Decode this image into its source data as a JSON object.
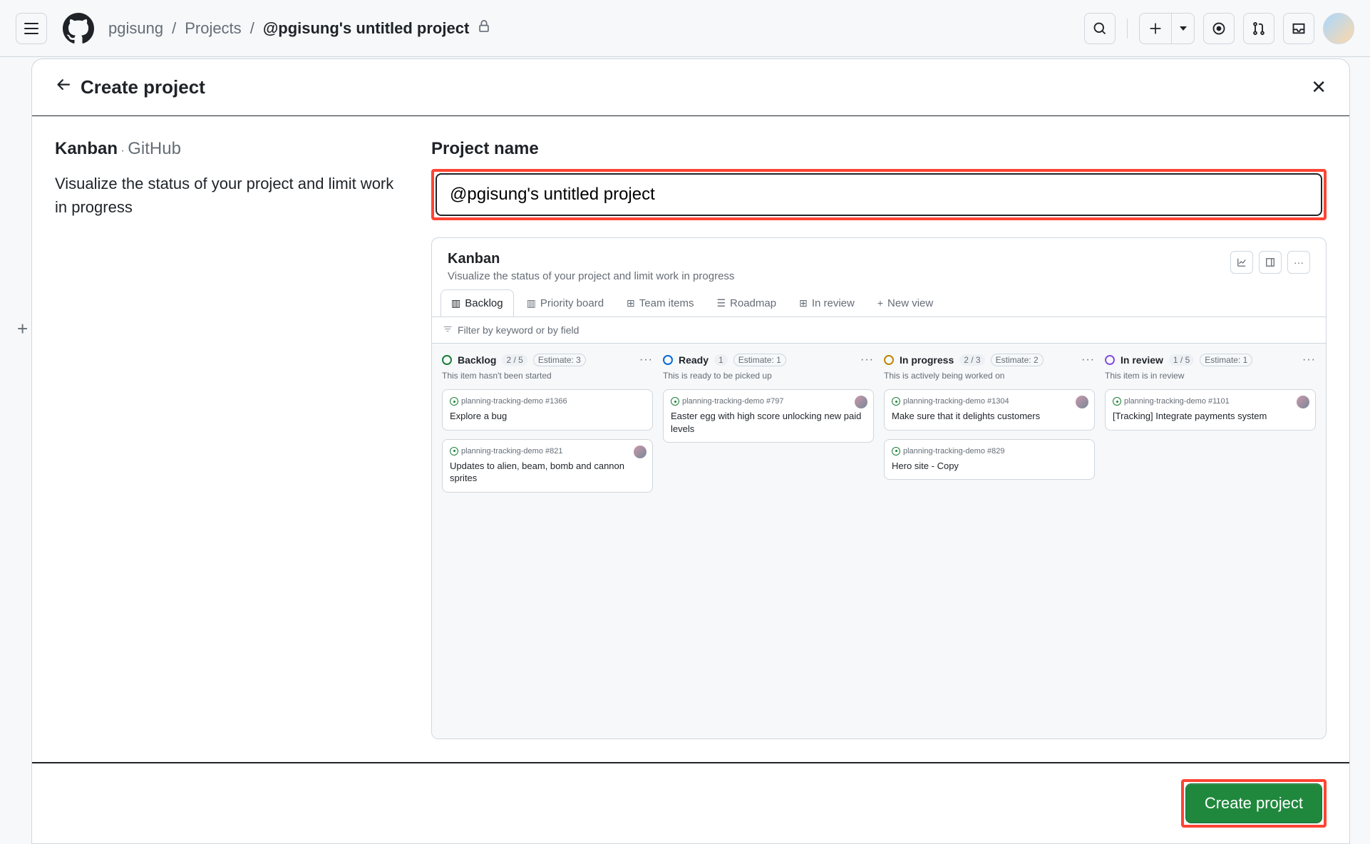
{
  "header": {
    "breadcrumb_user": "pgisung",
    "breadcrumb_projects": "Projects",
    "breadcrumb_current": "@pgisung's untitled project"
  },
  "modal": {
    "title": "Create project",
    "template_name": "Kanban",
    "template_source": "GitHub",
    "template_desc": "Visualize the status of your project and limit work in progress",
    "field_label": "Project name",
    "name_value": "@pgisung's untitled project",
    "create_button": "Create project"
  },
  "preview": {
    "title": "Kanban",
    "subtitle": "Visualize the status of your project and limit work in progress",
    "tabs": [
      {
        "label": "Backlog",
        "active": true
      },
      {
        "label": "Priority board"
      },
      {
        "label": "Team items"
      },
      {
        "label": "Roadmap"
      },
      {
        "label": "In review"
      },
      {
        "label": "New view"
      }
    ],
    "filter_placeholder": "Filter by keyword or by field",
    "columns": [
      {
        "title": "Backlog",
        "count": "2 / 5",
        "estimate": "Estimate: 3",
        "subtitle": "This item hasn't been started",
        "color": "green",
        "cards": [
          {
            "repo": "planning-tracking-demo #1366",
            "title": "Explore a bug",
            "avatar": false
          },
          {
            "repo": "planning-tracking-demo #821",
            "title": "Updates to alien, beam, bomb and cannon sprites",
            "avatar": true
          }
        ]
      },
      {
        "title": "Ready",
        "count": "1",
        "estimate": "Estimate: 1",
        "subtitle": "This is ready to be picked up",
        "color": "blue",
        "cards": [
          {
            "repo": "planning-tracking-demo #797",
            "title": "Easter egg with high score unlocking new paid levels",
            "avatar": true
          }
        ]
      },
      {
        "title": "In progress",
        "count": "2 / 3",
        "estimate": "Estimate: 2",
        "subtitle": "This is actively being worked on",
        "color": "yellow",
        "cards": [
          {
            "repo": "planning-tracking-demo #1304",
            "title": "Make sure that it delights customers",
            "avatar": true
          },
          {
            "repo": "planning-tracking-demo #829",
            "title": "Hero site - Copy",
            "avatar": false
          }
        ]
      },
      {
        "title": "In review",
        "count": "1 / 5",
        "estimate": "Estimate: 1",
        "subtitle": "This item is in review",
        "color": "purple",
        "cards": [
          {
            "repo": "planning-tracking-demo #1101",
            "title": "[Tracking] Integrate payments system",
            "avatar": true
          }
        ]
      }
    ]
  }
}
